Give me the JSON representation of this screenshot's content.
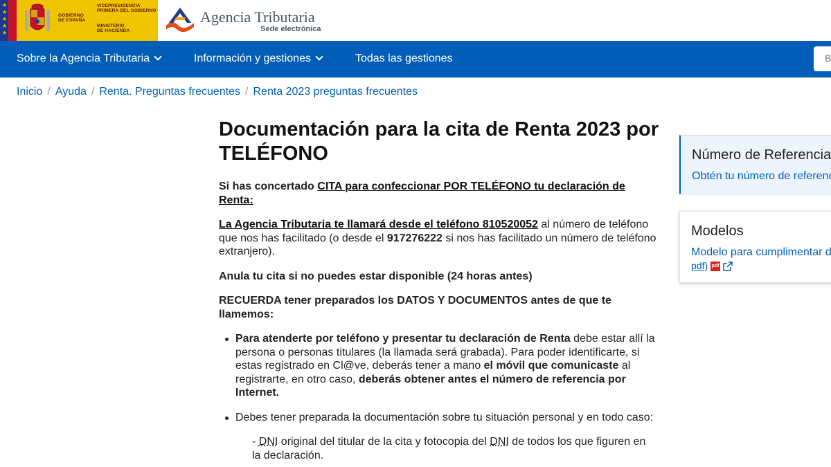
{
  "header": {
    "gov": {
      "gobierno": [
        "GOBIERNO",
        "DE ESPAÑA"
      ],
      "vice": [
        "VICEPRESIDENCIA",
        "PRIMERA DEL GOBIERNO"
      ],
      "ministerio": [
        "MINISTERIO",
        "DE HACIENDA"
      ]
    },
    "agency_name": "Agencia Tributaria",
    "agency_sub": "Sede electrónica"
  },
  "nav": {
    "items": [
      {
        "label": "Sobre la Agencia Tributaria",
        "has_dropdown": true
      },
      {
        "label": "Información y gestiones",
        "has_dropdown": true
      },
      {
        "label": "Todas las gestiones",
        "has_dropdown": false
      }
    ],
    "search_placeholder": "B"
  },
  "breadcrumb": [
    "Inicio",
    "Ayuda",
    "Renta. Preguntas frecuentes",
    "Renta 2023 preguntas frecuentes"
  ],
  "main": {
    "title": "Documentación para la cita de Renta 2023 por TELÉFONO",
    "intro_prefix": "Si has concertado ",
    "intro_link": "CITA para confeccionar POR TELÉFONO tu declaración de Renta:",
    "call_link": "La Agencia Tributaria te llamará desde el teléfono 810520052",
    "call_text_1": " al número de teléfono que nos has facilitado (o desde el ",
    "call_phone_2": "917276222",
    "call_text_2": " si nos has facilitado un número de teléfono extranjero).",
    "cancel": "Anula tu cita si no puedes estar disponible (24 horas antes)",
    "remember": "RECUERDA tener preparados los DATOS Y DOCUMENTOS antes de que te llamemos:",
    "bullet1": {
      "bold1": "Para atenderte por teléfono y presentar tu declaración de Renta",
      "text1": " debe estar allí la persona o personas titulares (la llamada será grabada). Para poder identificarte, si estas registrado en Cl@ve, deberás tener a mano ",
      "bold2": "el móvil que comunicaste",
      "text2": " al registrarte, en otro caso, ",
      "bold3": "deberás obtener antes el número de referencia por Internet."
    },
    "bullet2": "Debes tener preparada la documentación sobre tu situación personal y en todo caso:",
    "sub": {
      "dash": "- ",
      "dni1": "DNI",
      "text1": " original del titular de la cita y fotocopia del ",
      "dni2": "DNI",
      "text2": " de todos los que figuren en la declaración."
    }
  },
  "sidebar": {
    "card1": {
      "title": "Número de Referencia",
      "link": "Obtén tu número de referencia"
    },
    "card2": {
      "title": "Modelos",
      "link": "Modelo para cumplimentar d",
      "link2": "pdf)",
      "pdf_icon": "pdf-icon",
      "ext_icon": "external-link-icon"
    }
  },
  "colors": {
    "nav_bg": "#005eb8",
    "link": "#005eb8",
    "gov_yellow": "#f1c400",
    "eu_blue": "#1d3a8f"
  }
}
